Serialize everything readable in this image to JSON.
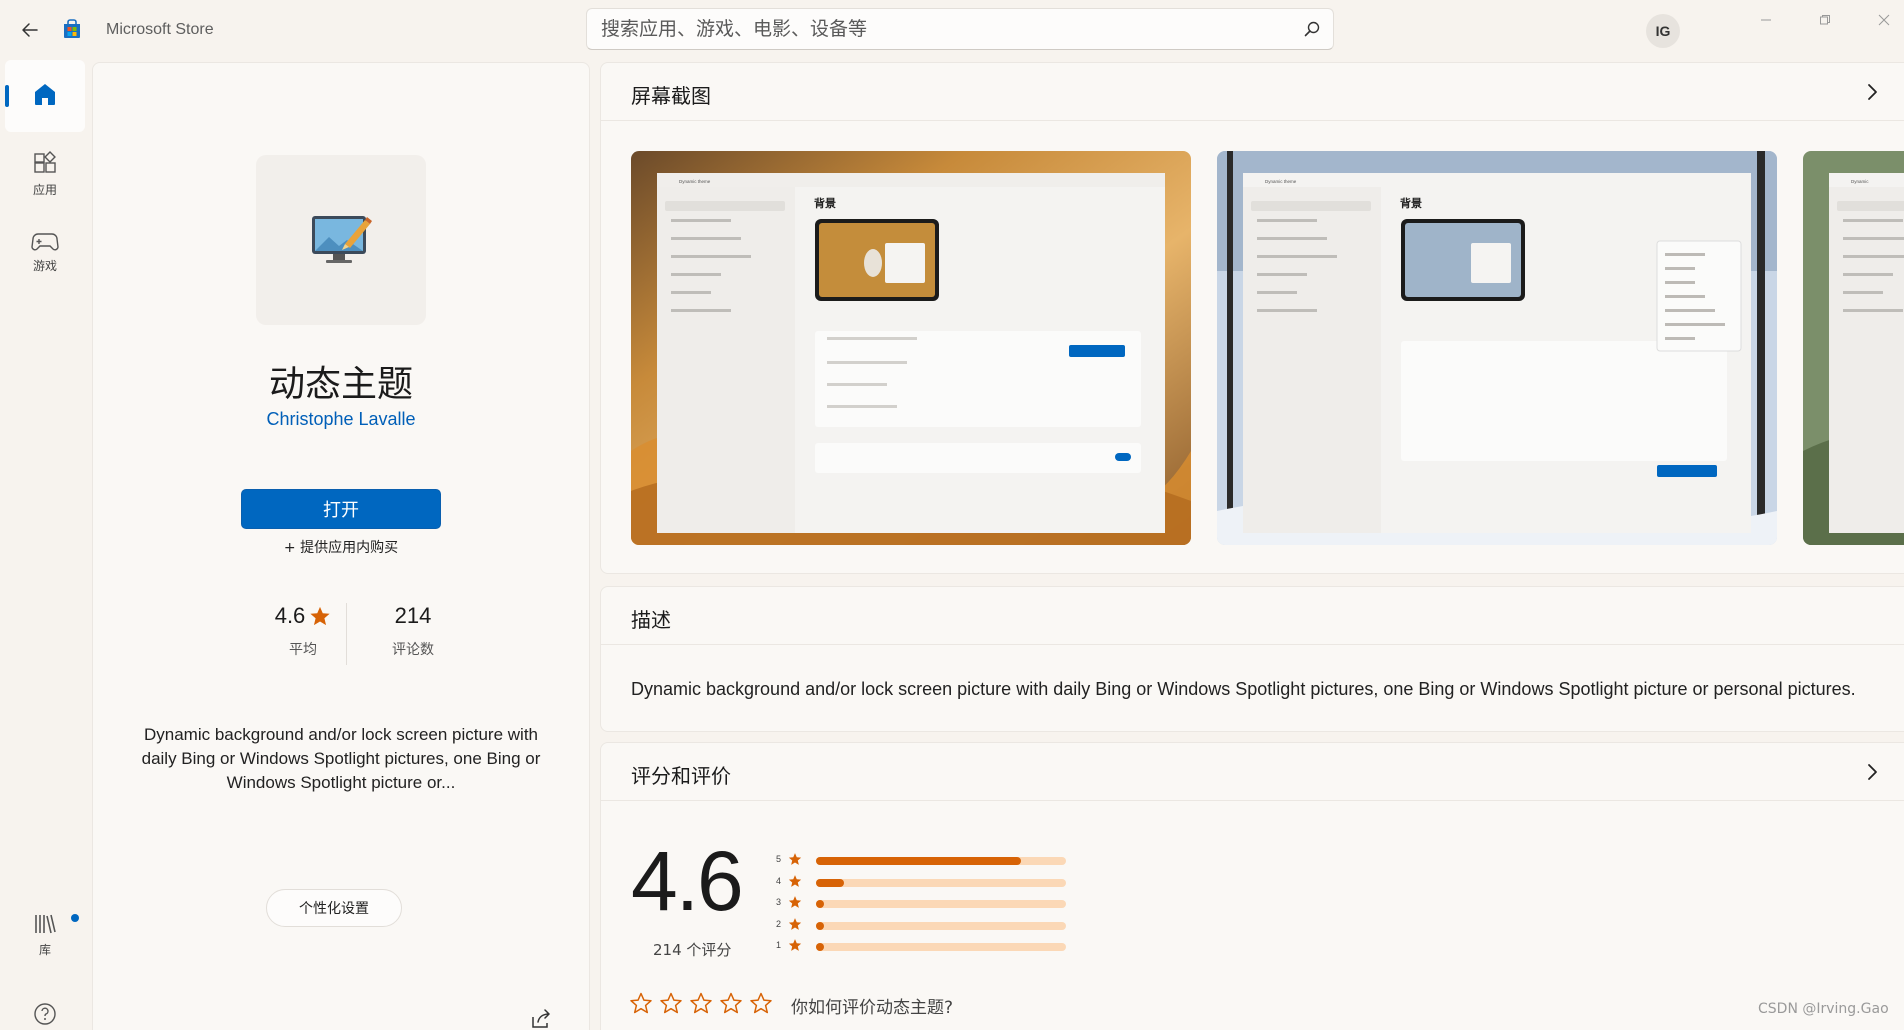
{
  "window": {
    "title": "Microsoft Store"
  },
  "search": {
    "placeholder": "搜索应用、游戏、电影、设备等"
  },
  "user": {
    "initials": "IG"
  },
  "nav": {
    "items": [
      {
        "id": "home",
        "label": "",
        "active": true
      },
      {
        "id": "apps",
        "label": "应用"
      },
      {
        "id": "games",
        "label": "游戏"
      },
      {
        "id": "library",
        "label": "库",
        "has_notification": true
      },
      {
        "id": "help",
        "label": ""
      }
    ]
  },
  "app": {
    "name": "动态主题",
    "publisher": "Christophe Lavalle",
    "primary_action": "打开",
    "in_app_purchase": "+ 提供应用内购买",
    "rating": "4.6",
    "rating_label": "平均",
    "review_count": "214",
    "review_count_label": "评论数",
    "short_description": "Dynamic background and/or lock screen picture with daily Bing or Windows Spotlight pictures, one Bing or Windows Spotlight picture or...",
    "category": "个性化设置"
  },
  "screenshots": {
    "title": "屏幕截图",
    "items": [
      {
        "heading": "背景",
        "app_label": "Dynamic theme"
      },
      {
        "heading": "背景",
        "app_label": "Dynamic theme"
      },
      {
        "heading": "",
        "app_label": "Dynamic"
      }
    ]
  },
  "description": {
    "title": "描述",
    "text": "Dynamic background and/or lock screen picture with daily Bing or Windows Spotlight pictures, one Bing or Windows Spotlight picture or personal pictures."
  },
  "ratings": {
    "title": "评分和评价",
    "average": "4.6",
    "count_text": "214 个评分",
    "distribution": [
      {
        "stars": "5",
        "fraction": 0.82
      },
      {
        "stars": "4",
        "fraction": 0.11
      },
      {
        "stars": "3",
        "fraction": 0.03
      },
      {
        "stars": "2",
        "fraction": 0.02
      },
      {
        "stars": "1",
        "fraction": 0.03
      }
    ],
    "prompt": "你如何评价动态主题?"
  },
  "watermark": "CSDN @Irving.Gao",
  "colors": {
    "accent": "#0067c0",
    "star": "#d76306",
    "star_track": "#fbd8b6",
    "background": "#f7f3ee"
  }
}
